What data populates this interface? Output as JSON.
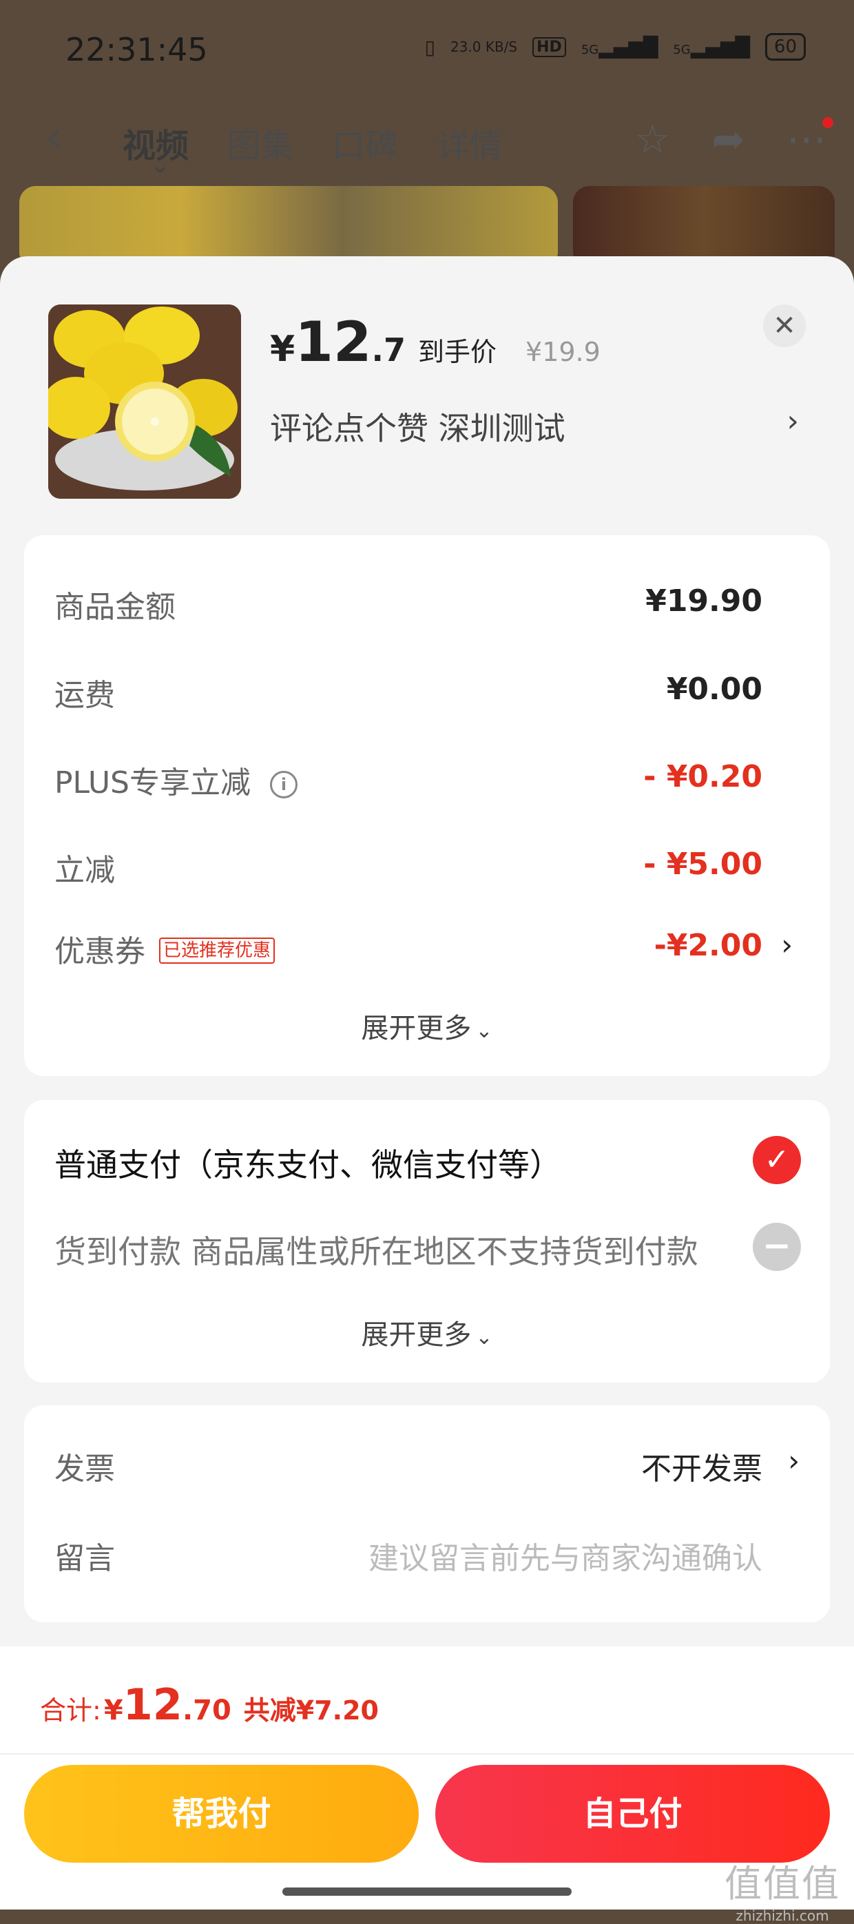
{
  "status_bar": {
    "time": "22:31:45",
    "net_speed": "23.0 KB/S",
    "hd_label": "HD",
    "signal1_label": "5G",
    "signal2_label": "5G",
    "battery": "60"
  },
  "nav": {
    "tabs": [
      {
        "label": "视频",
        "active": true
      },
      {
        "label": "图集"
      },
      {
        "label": "口碑"
      },
      {
        "label": "详情"
      }
    ]
  },
  "product": {
    "price_yen": "¥",
    "price_int": "12",
    "price_dec": ".7",
    "price_tag": "到手价",
    "original_price": "¥19.9",
    "title": "评论点个赞  深圳测试"
  },
  "amounts": {
    "rows": [
      {
        "label": "商品金额",
        "value": "¥19.90"
      },
      {
        "label": "运费",
        "value": "¥0.00"
      },
      {
        "label": "PLUS专享立减",
        "value": "- ¥0.20"
      },
      {
        "label": "立减",
        "value": "- ¥5.00"
      },
      {
        "label": "优惠券",
        "badge": "已选推荐优惠",
        "value": "-¥2.00"
      }
    ],
    "expand": "展开更多"
  },
  "payment": {
    "option1": "普通支付（京东支付、微信支付等）",
    "option2": "货到付款 商品属性或所在地区不支持货到付款",
    "expand": "展开更多"
  },
  "invoice": {
    "label": "发票",
    "value": "不开发票",
    "message_label": "留言",
    "message_placeholder": "建议留言前先与商家沟通确认"
  },
  "footer": {
    "total_label": "合计:",
    "total_yen": "¥",
    "total_int": "12",
    "total_dec": ".70",
    "total_saved": "共减¥7.20",
    "btn_friend": "帮我付",
    "btn_self": "自己付"
  },
  "watermark": {
    "line1": "值值值",
    "line2": "zhizhizhi.com"
  },
  "colors": {
    "accent_red": "#e3301f",
    "friend_button": "#ffb814",
    "self_button": "#f7364e"
  }
}
